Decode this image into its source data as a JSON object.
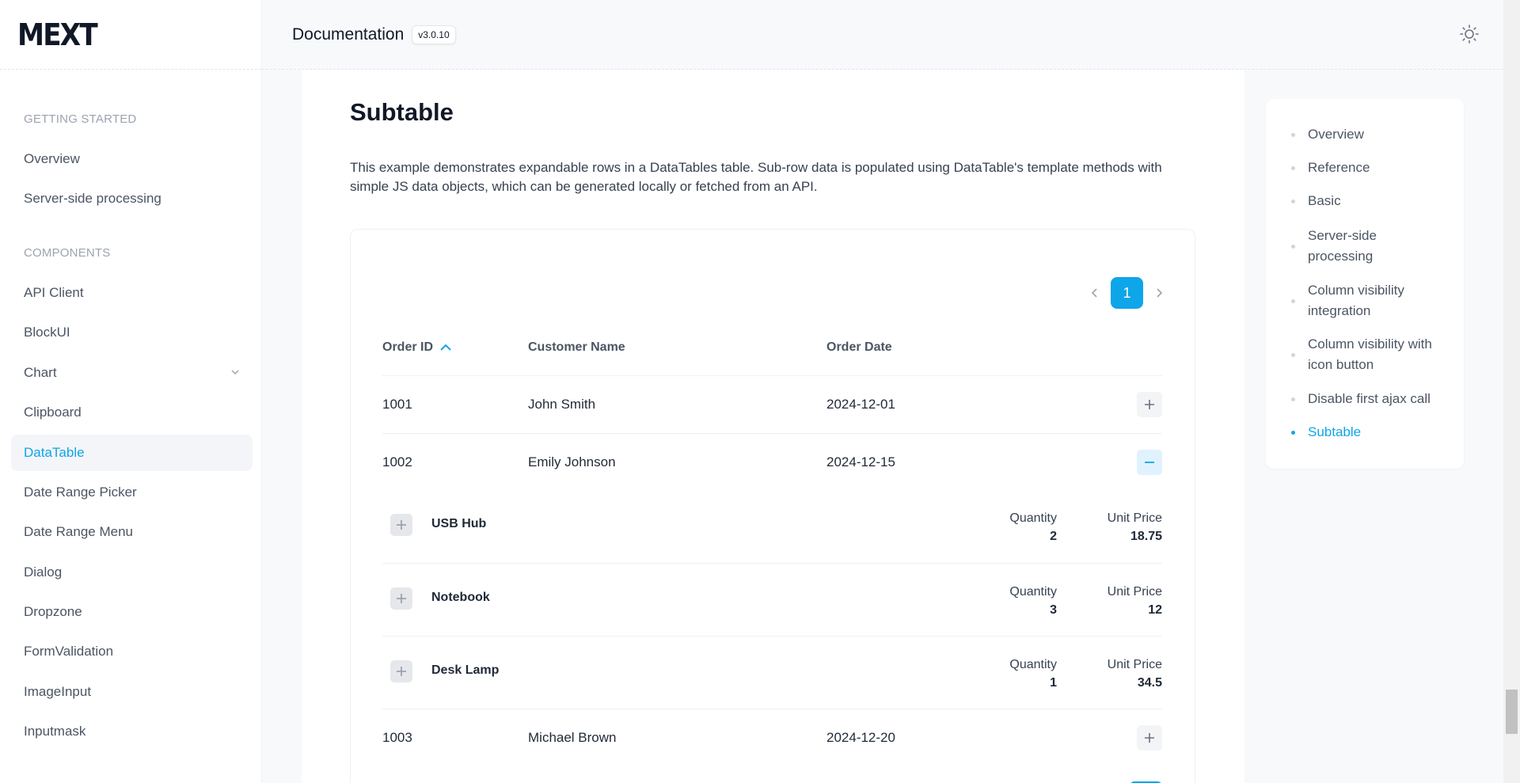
{
  "brand": {
    "logo_text": "MEXT"
  },
  "header": {
    "title": "Documentation",
    "version": "v3.0.10",
    "theme_icon": "sun-icon"
  },
  "sidebar": {
    "sections": [
      {
        "label": "GETTING STARTED",
        "items": [
          "Overview",
          "Server-side processing"
        ]
      },
      {
        "label": "COMPONENTS",
        "items": [
          "API Client",
          "BlockUI",
          "Chart",
          "Clipboard",
          "DataTable",
          "Date Range Picker",
          "Date Range Menu",
          "Dialog",
          "Dropzone",
          "FormValidation",
          "ImageInput",
          "Inputmask"
        ]
      }
    ],
    "active_item": "DataTable",
    "expandable_item": "Chart"
  },
  "main": {
    "title": "Subtable",
    "intro": "This example demonstrates expandable rows in a DataTables table. Sub-row data is populated using DataTable's template methods with simple JS data objects, which can be generated locally or fetched from an API.",
    "pagination": {
      "current_page": "1"
    },
    "table": {
      "columns": [
        "Order ID",
        "Customer Name",
        "Order Date"
      ],
      "sort_column": "Order ID",
      "rows": [
        {
          "id": "1001",
          "customer": "John Smith",
          "date": "2024-12-01",
          "expanded": false
        },
        {
          "id": "1002",
          "customer": "Emily Johnson",
          "date": "2024-12-15",
          "expanded": true
        },
        {
          "id": "1003",
          "customer": "Michael Brown",
          "date": "2024-12-20",
          "expanded": false
        }
      ],
      "subrows": [
        {
          "name": "USB Hub",
          "quantity_label": "Quantity",
          "quantity": "2",
          "price_label": "Unit Price",
          "price": "18.75"
        },
        {
          "name": "Notebook",
          "quantity_label": "Quantity",
          "quantity": "3",
          "price_label": "Unit Price",
          "price": "12"
        },
        {
          "name": "Desk Lamp",
          "quantity_label": "Quantity",
          "quantity": "1",
          "price_label": "Unit Price",
          "price": "34.5"
        }
      ]
    }
  },
  "toc": {
    "items": [
      "Overview",
      "Reference",
      "Basic",
      "Server-side processing",
      "Column visibility integration",
      "Column visibility with icon button",
      "Disable first ajax call",
      "Subtable"
    ],
    "active_item": "Subtable"
  },
  "colors": {
    "accent": "#0ea5e9",
    "text": "#1f2937",
    "muted": "#9ca3af"
  }
}
